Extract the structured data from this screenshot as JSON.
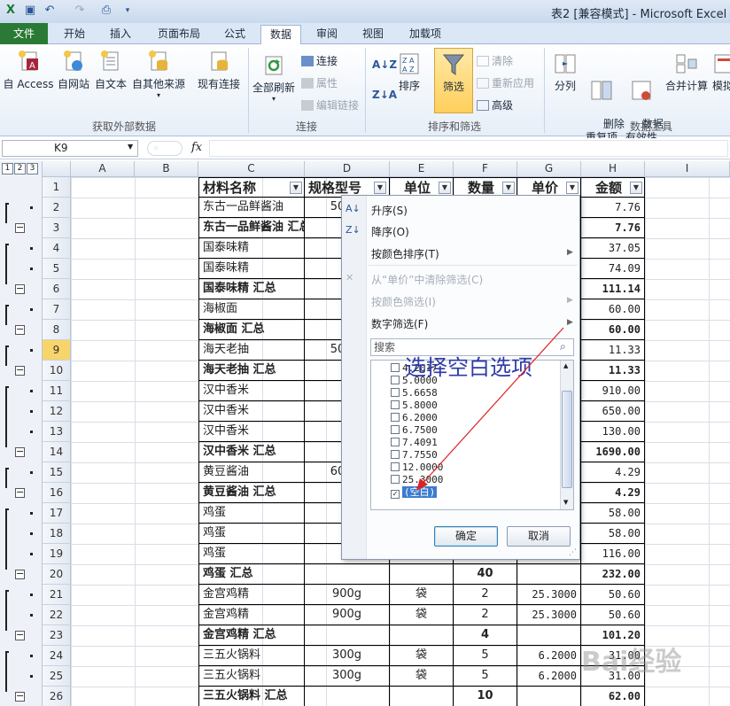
{
  "window": {
    "title": "表2 [兼容模式] - Microsoft Excel"
  },
  "tabs": [
    {
      "id": "file",
      "label": "文件"
    },
    {
      "id": "home",
      "label": "开始"
    },
    {
      "id": "insert",
      "label": "插入"
    },
    {
      "id": "layout",
      "label": "页面布局"
    },
    {
      "id": "formulas",
      "label": "公式"
    },
    {
      "id": "data",
      "label": "数据"
    },
    {
      "id": "review",
      "label": "审阅"
    },
    {
      "id": "view",
      "label": "视图"
    },
    {
      "id": "addins",
      "label": "加载项"
    }
  ],
  "ribbon": {
    "get_external": {
      "label": "获取外部数据",
      "buttons": [
        "自 Access",
        "自网站",
        "自文本",
        "自其他来源",
        "现有连接"
      ]
    },
    "connections": {
      "label": "连接",
      "refresh_all": "全部刷新",
      "items": [
        "连接",
        "属性",
        "编辑链接"
      ]
    },
    "sort_filter": {
      "label": "排序和筛选",
      "sort": "排序",
      "filter": "筛选",
      "items": [
        "清除",
        "重新应用",
        "高级"
      ]
    },
    "data_tools": {
      "label": "数据工具",
      "buttons": [
        "分列",
        "删除\n重复项",
        "数据\n有效性",
        "合并计算",
        "模拟"
      ]
    }
  },
  "formula_bar": {
    "name_box": "K9",
    "fx": "fx",
    "value": ""
  },
  "outline_levels": [
    "1",
    "2",
    "3"
  ],
  "columns": [
    "A",
    "B",
    "C",
    "D",
    "E",
    "F",
    "G",
    "H",
    "I"
  ],
  "sheet": {
    "selected_row": "9",
    "header": {
      "c": "材料名称",
      "d": "规格型号",
      "e": "单位",
      "f": "数量",
      "g": "单价",
      "h": "金额"
    },
    "rows": [
      {
        "n": "2",
        "c": "东古一品鲜酱油",
        "d": "500m",
        "h": "7.76"
      },
      {
        "n": "3",
        "c": "东古一品鲜酱油 汇总",
        "bold": true,
        "h": "7.76"
      },
      {
        "n": "4",
        "c": "国泰味精",
        "d": "4",
        "h": "37.05"
      },
      {
        "n": "5",
        "c": "国泰味精",
        "d": "4",
        "h": "74.09"
      },
      {
        "n": "6",
        "c": "国泰味精 汇总",
        "bold": true,
        "h": "111.14"
      },
      {
        "n": "7",
        "c": "海椒面",
        "h": "60.00"
      },
      {
        "n": "8",
        "c": "海椒面 汇总",
        "bold": true,
        "h": "60.00"
      },
      {
        "n": "9",
        "c": "海天老抽",
        "d": "500m",
        "h": "11.33"
      },
      {
        "n": "10",
        "c": "海天老抽 汇总",
        "bold": true,
        "h": "11.33"
      },
      {
        "n": "11",
        "c": "汉中香米",
        "h": "910.00"
      },
      {
        "n": "12",
        "c": "汉中香米",
        "h": "650.00"
      },
      {
        "n": "13",
        "c": "汉中香米",
        "h": "130.00"
      },
      {
        "n": "14",
        "c": "汉中香米 汇总",
        "bold": true,
        "h": "1690.00"
      },
      {
        "n": "15",
        "c": "黄豆酱油",
        "d": "600m",
        "h": "4.29"
      },
      {
        "n": "16",
        "c": "黄豆酱油 汇总",
        "bold": true,
        "h": "4.29"
      },
      {
        "n": "17",
        "c": "鸡蛋",
        "h": "58.00"
      },
      {
        "n": "18",
        "c": "鸡蛋",
        "h": "58.00"
      },
      {
        "n": "19",
        "c": "鸡蛋",
        "h": "116.00"
      },
      {
        "n": "20",
        "c": "鸡蛋 汇总",
        "bold": true,
        "f": "40",
        "h": "232.00"
      },
      {
        "n": "21",
        "c": "金宫鸡精",
        "d": "900g",
        "e": "袋",
        "f": "2",
        "g": "25.3000",
        "h": "50.60"
      },
      {
        "n": "22",
        "c": "金宫鸡精",
        "d": "900g",
        "e": "袋",
        "f": "2",
        "g": "25.3000",
        "h": "50.60"
      },
      {
        "n": "23",
        "c": "金宫鸡精 汇总",
        "bold": true,
        "f": "4",
        "h": "101.20"
      },
      {
        "n": "24",
        "c": "三五火锅料",
        "d": "300g",
        "e": "袋",
        "f": "5",
        "g": "6.2000",
        "h": "31.00"
      },
      {
        "n": "25",
        "c": "三五火锅料",
        "d": "300g",
        "e": "袋",
        "f": "5",
        "g": "6.2000",
        "h": "31.00"
      },
      {
        "n": "26",
        "c": "三五火锅料 汇总",
        "bold": true,
        "f": "10",
        "h": "62.00"
      }
    ]
  },
  "filter_panel": {
    "sort_asc": "升序(S)",
    "sort_desc": "降序(O)",
    "sort_color": "按颜色排序(T)",
    "clear": "从“单价”中清除筛选(C)",
    "filter_color": "按颜色筛选(I)",
    "number_filter": "数字筛选(F)",
    "search_placeholder": "搜索",
    "values": [
      "4.2017",
      "5.0000",
      "5.6658",
      "5.8000",
      "6.2000",
      "6.7500",
      "7.4091",
      "7.7550",
      "12.0000",
      "25.3000"
    ],
    "blank_label": "(空白)",
    "ok": "确定",
    "cancel": "取消"
  },
  "annotation": "选择空白选项",
  "watermark": "Bai经验"
}
